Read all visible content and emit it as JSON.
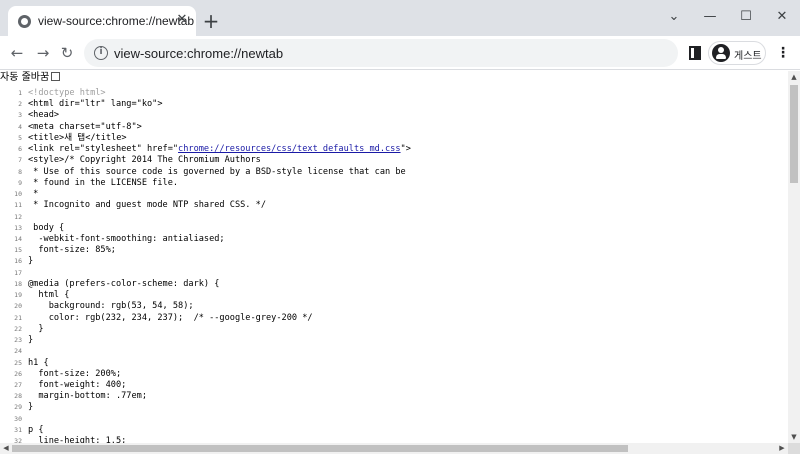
{
  "tab": {
    "title": "view-source:chrome://newtab",
    "close": "✕"
  },
  "new_tab": "+",
  "window_controls": {
    "minimize": "—",
    "maximize": "☐",
    "close": "✕",
    "dropdown": "⌄"
  },
  "nav": {
    "back": "←",
    "forward": "→",
    "reload": "↻"
  },
  "omnibox": {
    "info_icon": "i",
    "url": "view-source:chrome://newtab"
  },
  "profile": {
    "label": "게스트"
  },
  "menu": "⋮",
  "wrap": {
    "label": "자동 줄바꿈"
  },
  "lines": [
    {
      "n": "1",
      "t": "<!doctype html>"
    },
    {
      "n": "2",
      "t": "<html dir=\"ltr\" lang=\"ko\">"
    },
    {
      "n": "3",
      "t": "<head>"
    },
    {
      "n": "4",
      "t": "<meta charset=\"utf-8\">"
    },
    {
      "n": "5",
      "t": "<title>새 탭</title>"
    },
    {
      "n": "6",
      "t": "<link rel=\"stylesheet\" href=\"",
      "link": "chrome://resources/css/text_defaults_md.css",
      "after": "\">"
    },
    {
      "n": "7",
      "t": "<style>/* Copyright 2014 The Chromium Authors"
    },
    {
      "n": "8",
      "t": " * Use of this source code is governed by a BSD-style license that can be"
    },
    {
      "n": "9",
      "t": " * found in the LICENSE file."
    },
    {
      "n": "10",
      "t": " *"
    },
    {
      "n": "11",
      "t": " * Incognito and guest mode NTP shared CSS. */"
    },
    {
      "n": "12",
      "t": ""
    },
    {
      "n": "13",
      "t": " body {"
    },
    {
      "n": "14",
      "t": "  -webkit-font-smoothing: antialiased;"
    },
    {
      "n": "15",
      "t": "  font-size: 85%;"
    },
    {
      "n": "16",
      "t": "}"
    },
    {
      "n": "17",
      "t": ""
    },
    {
      "n": "18",
      "t": "@media (prefers-color-scheme: dark) {"
    },
    {
      "n": "19",
      "t": "  html {"
    },
    {
      "n": "20",
      "t": "    background: rgb(53, 54, 58);"
    },
    {
      "n": "21",
      "t": "    color: rgb(232, 234, 237);  /* --google-grey-200 */"
    },
    {
      "n": "22",
      "t": "  }"
    },
    {
      "n": "23",
      "t": "}"
    },
    {
      "n": "24",
      "t": ""
    },
    {
      "n": "25",
      "t": "h1 {"
    },
    {
      "n": "26",
      "t": "  font-size: 200%;"
    },
    {
      "n": "27",
      "t": "  font-weight: 400;"
    },
    {
      "n": "28",
      "t": "  margin-bottom: .77em;"
    },
    {
      "n": "29",
      "t": "}"
    },
    {
      "n": "30",
      "t": ""
    },
    {
      "n": "31",
      "t": "p {"
    },
    {
      "n": "32",
      "t": "  line-height: 1.5;"
    }
  ],
  "scroll": {
    "up": "▲",
    "down": "▼",
    "left": "◀",
    "right": "▶"
  }
}
